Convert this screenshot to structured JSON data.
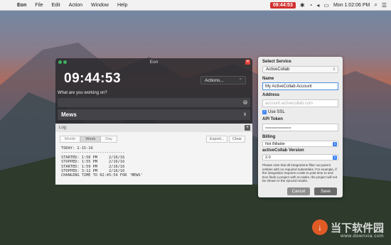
{
  "menubar": {
    "apple_icon": "apple-icon",
    "items": [
      "Eon",
      "File",
      "Edit",
      "Action",
      "Window",
      "Help"
    ],
    "timer_badge": "09:44:53",
    "clock": "Mon 1:02:06 PM"
  },
  "eon": {
    "window_title": "Eon",
    "timer": "09:44:53",
    "actions_label": "Actions...",
    "working_label": "What are you working on?",
    "working_value": "",
    "project": "Mews",
    "log_label": "Log",
    "tabs": [
      "Month",
      "Week",
      "Day"
    ],
    "export_label": "Export...",
    "clear_label": "Clear",
    "log_lines": [
      "TODAY: 2-15-16",
      "----------------------------",
      "STARTED: 1:50 PM     2/16/16",
      "STOPPED: 1:55 PM     2/16/16",
      "STARTED: 1:59 PM     2/16/16",
      "STOPPED: 3:12 PM     2/16/16",
      "CHANGING TIME TO 02:45:54 FOR 'MEWS'"
    ]
  },
  "settings": {
    "select_service_label": "Select Service",
    "service": "ActiveCollab",
    "name_label": "Name",
    "name_value": "My ActiveCollab Account",
    "address_label": "Address",
    "address_placeholder": "account.activecollab.com",
    "ssl_label": "Use SSL",
    "token_label": "API Token",
    "token_value": "••••••••••••••••••••••••••",
    "billing_label": "Billing",
    "billing_value": "Not Billable",
    "version_label": "activeCollab Version",
    "version_value": "2.0",
    "note": "Please note that all integrations filter out parent entities with no required subentities. For example, if the integration requires a task to post time to and Eon finds a project with no tasks, the project will not be shown in the synced results.",
    "cancel_label": "Cancel",
    "save_label": "Save"
  },
  "watermark": {
    "text": "当下软件园",
    "sub": "www.downxia.com"
  }
}
